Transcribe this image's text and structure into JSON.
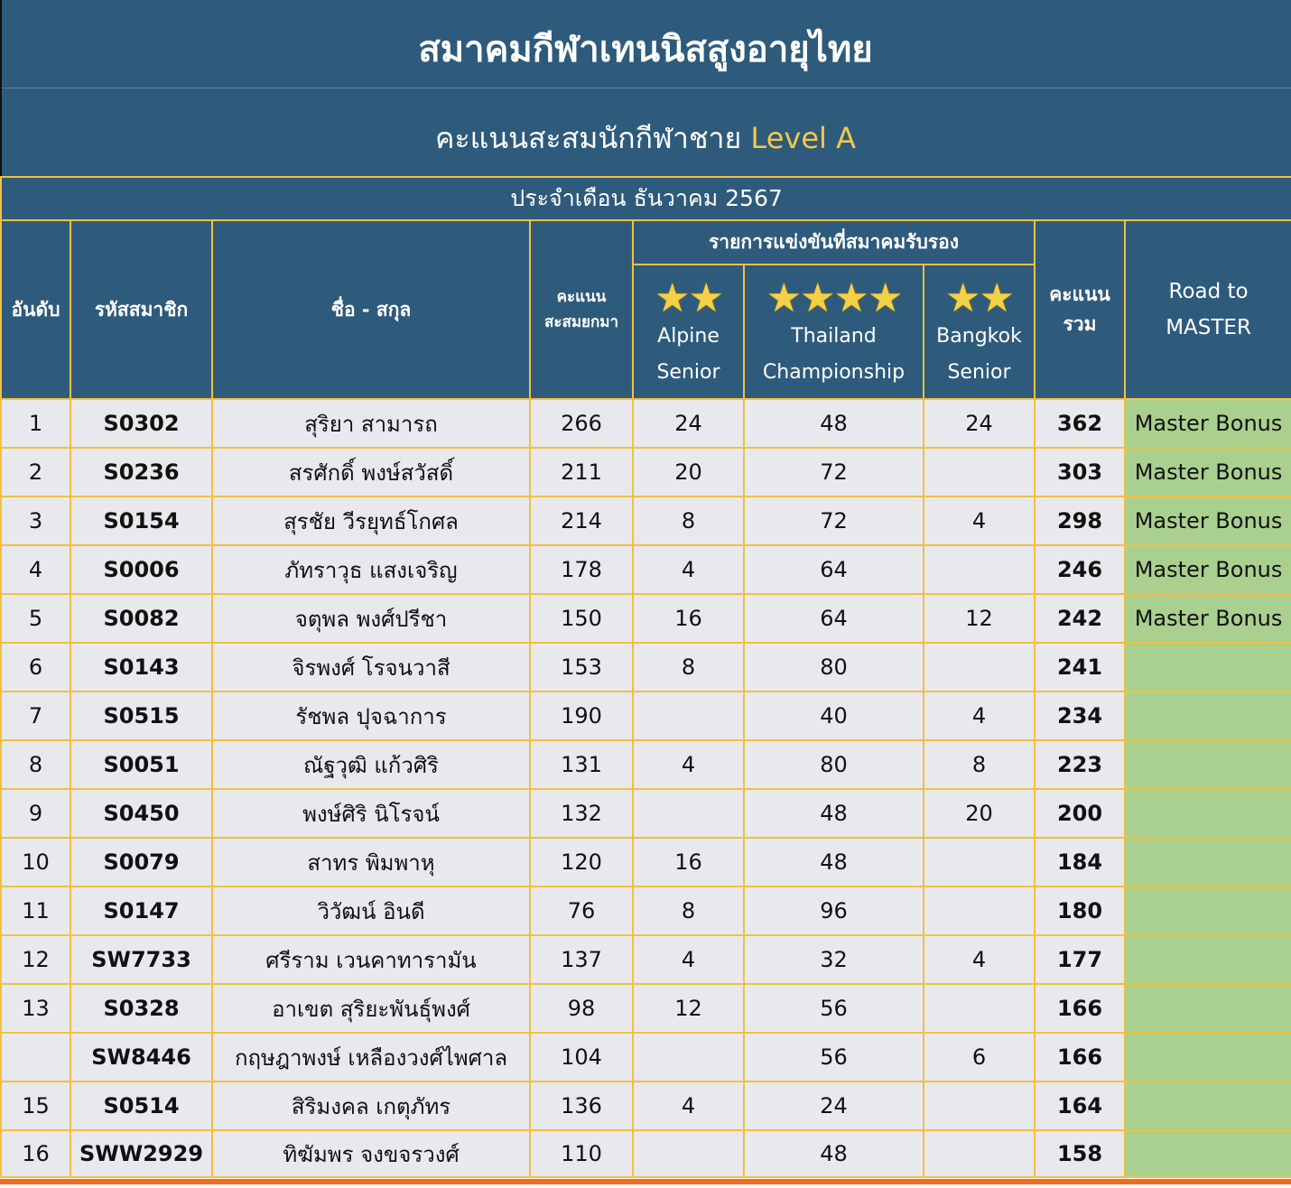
{
  "title": "สมาคมกีฬาเทนนิสสูงอายุไทย",
  "subtitle": {
    "prefix": "คะแนนสะสมนักกีฬาชาย",
    "level": "Level A"
  },
  "month_label": "ประจำเดือน ธันวาคม 2567",
  "headers": {
    "rank": "อันดับ",
    "member_code": "รหัสสมาชิก",
    "name": "ชื่อ - สกุล",
    "accumulated_line1": "คะแนน",
    "accumulated_line2": "สะสมยกมา",
    "events_group": "รายการแข่งขันที่สมาคมรับรอง",
    "total_line1": "คะแนน",
    "total_line2": "รวม",
    "road_line1": "Road to",
    "road_line2": "MASTER"
  },
  "events": [
    {
      "stars": "★★",
      "star_count": 2,
      "line1": "Alpine",
      "line2": "Senior"
    },
    {
      "stars": "★★★★",
      "star_count": 4,
      "line1": "Thailand",
      "line2": "Championship"
    },
    {
      "stars": "★★",
      "star_count": 2,
      "line1": "Bangkok",
      "line2": "Senior"
    }
  ],
  "colors": {
    "header_bg": "#2e5b7c",
    "grid_border": "#f2c040",
    "level_text": "#f2c94c",
    "row_bg": "#e8e9ed",
    "road_bg": "#a9d08e",
    "bottom_bar": "#f26b1d"
  },
  "rows": [
    {
      "rank": "1",
      "code": "S0302",
      "name": "สุริยา  สามารถ",
      "acc": "266",
      "alpine": "24",
      "thailand": "48",
      "bangkok": "24",
      "total": "362",
      "road": "Master Bonus"
    },
    {
      "rank": "2",
      "code": "S0236",
      "name": "สรศักดิ์  พงษ์สวัสดิ์",
      "acc": "211",
      "alpine": "20",
      "thailand": "72",
      "bangkok": "",
      "total": "303",
      "road": "Master Bonus"
    },
    {
      "rank": "3",
      "code": "S0154",
      "name": "สุรชัย  วีรยุทธ์โกศล",
      "acc": "214",
      "alpine": "8",
      "thailand": "72",
      "bangkok": "4",
      "total": "298",
      "road": "Master Bonus"
    },
    {
      "rank": "4",
      "code": "S0006",
      "name": "ภัทราวุธ  แสงเจริญ",
      "acc": "178",
      "alpine": "4",
      "thailand": "64",
      "bangkok": "",
      "total": "246",
      "road": "Master Bonus"
    },
    {
      "rank": "5",
      "code": "S0082",
      "name": "จตุพล  พงศ์ปรีชา",
      "acc": "150",
      "alpine": "16",
      "thailand": "64",
      "bangkok": "12",
      "total": "242",
      "road": "Master Bonus"
    },
    {
      "rank": "6",
      "code": "S0143",
      "name": "จิรพงศ์  โรจนวาสี",
      "acc": "153",
      "alpine": "8",
      "thailand": "80",
      "bangkok": "",
      "total": "241",
      "road": ""
    },
    {
      "rank": "7",
      "code": "S0515",
      "name": "รัชพล  ปุจฉาการ",
      "acc": "190",
      "alpine": "",
      "thailand": "40",
      "bangkok": "4",
      "total": "234",
      "road": ""
    },
    {
      "rank": "8",
      "code": "S0051",
      "name": "ณัฐวุฒิ แก้วศิริ",
      "acc": "131",
      "alpine": "4",
      "thailand": "80",
      "bangkok": "8",
      "total": "223",
      "road": ""
    },
    {
      "rank": "9",
      "code": "S0450",
      "name": "พงษ์ศิริ  นิโรจน์",
      "acc": "132",
      "alpine": "",
      "thailand": "48",
      "bangkok": "20",
      "total": "200",
      "road": ""
    },
    {
      "rank": "10",
      "code": "S0079",
      "name": "สาทร  พิมพาหุ",
      "acc": "120",
      "alpine": "16",
      "thailand": "48",
      "bangkok": "",
      "total": "184",
      "road": ""
    },
    {
      "rank": "11",
      "code": "S0147",
      "name": "วิวัฒน์  อินดี",
      "acc": "76",
      "alpine": "8",
      "thailand": "96",
      "bangkok": "",
      "total": "180",
      "road": ""
    },
    {
      "rank": "12",
      "code": "SW7733",
      "name": "ศรีราม  เวนคาทารามัน",
      "acc": "137",
      "alpine": "4",
      "thailand": "32",
      "bangkok": "4",
      "total": "177",
      "road": ""
    },
    {
      "rank": "13",
      "code": "S0328",
      "name": "อาเขต สุริยะพันธุ์พงศ์",
      "acc": "98",
      "alpine": "12",
      "thailand": "56",
      "bangkok": "",
      "total": "166",
      "road": ""
    },
    {
      "rank": "",
      "code": "SW8446",
      "name": "กฤษฎาพงษ์  เหลืองวงศ์ไพศาล",
      "acc": "104",
      "alpine": "",
      "thailand": "56",
      "bangkok": "6",
      "total": "166",
      "road": ""
    },
    {
      "rank": "15",
      "code": "S0514",
      "name": "สิริมงคล  เกตุภัทร",
      "acc": "136",
      "alpine": "4",
      "thailand": "24",
      "bangkok": "",
      "total": "164",
      "road": ""
    },
    {
      "rank": "16",
      "code": "SWW2929",
      "name": "ทิฆัมพร  จงขจรวงศ์",
      "acc": "110",
      "alpine": "",
      "thailand": "48",
      "bangkok": "",
      "total": "158",
      "road": ""
    }
  ]
}
